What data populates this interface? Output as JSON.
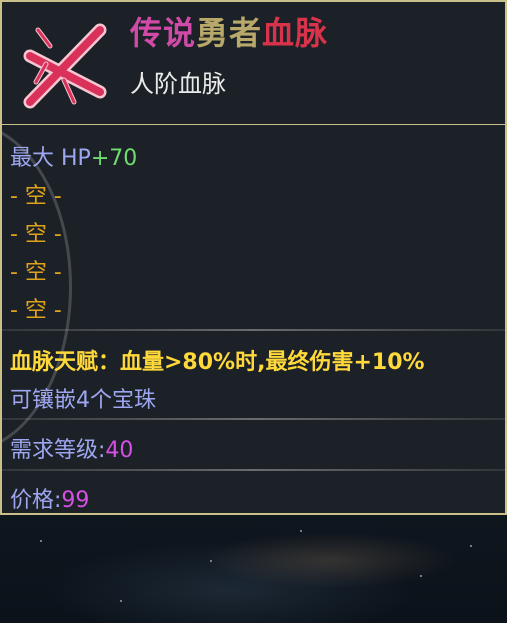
{
  "item": {
    "name_part1": "传说",
    "name_part2": "勇者",
    "name_part3": "血脉",
    "subtitle": "人阶血脉",
    "icon": "crossed-sword-icon",
    "name_colors": {
      "legendary": "#d04aa8",
      "mid": "#b8a86a",
      "bloodline": "#d8334a"
    }
  },
  "stats": {
    "max_hp_label": "最大 HP",
    "max_hp_value": "+70"
  },
  "empty_slots": [
    "- 空 -",
    "- 空 -",
    "- 空 -",
    "- 空 -"
  ],
  "talent": {
    "text": "血脉天赋：血量>80%时,最终伤害+10%"
  },
  "socket": {
    "text": "可镶嵌4个宝珠"
  },
  "requirement": {
    "label": "需求等级:",
    "value": "40"
  },
  "price": {
    "label": "价格:",
    "value": "99"
  }
}
